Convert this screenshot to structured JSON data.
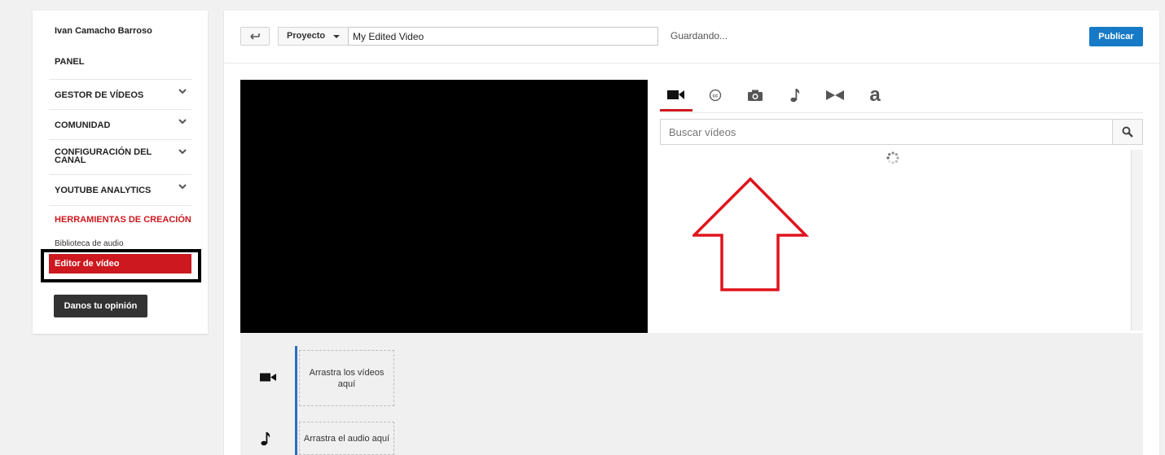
{
  "sidebar": {
    "user_name": "Ivan Camacho Barroso",
    "panel": "PANEL",
    "groups": [
      {
        "label": "GESTOR DE VÍDEOS"
      },
      {
        "label": "COMUNIDAD"
      },
      {
        "label": "CONFIGURACIÓN DEL CANAL"
      },
      {
        "label": "YOUTUBE ANALYTICS"
      }
    ],
    "creation_tools": "HERRAMIENTAS DE CREACIÓN",
    "audio_library": "Biblioteca de audio",
    "video_editor": "Editor de vídeo",
    "feedback_button": "Danos tu opinión"
  },
  "header": {
    "project_label": "Proyecto",
    "title_value": "My Edited Video",
    "status": "Guardando...",
    "publish_label": "Publicar"
  },
  "tabs": [
    {
      "icon": "video-camera-icon",
      "active": true
    },
    {
      "icon": "closed-captions-icon",
      "active": false
    },
    {
      "icon": "camera-icon",
      "active": false
    },
    {
      "icon": "music-note-icon",
      "active": false
    },
    {
      "icon": "transitions-icon",
      "active": false
    },
    {
      "icon": "text-icon",
      "active": false
    }
  ],
  "search": {
    "placeholder": "Buscar vídeos"
  },
  "timeline": {
    "video_drop": "Arrastra los vídeos aquí",
    "audio_drop": "Arrastra el audio aquí"
  },
  "colors": {
    "accent_red": "#cc181e",
    "publish_blue": "#167ac6",
    "annotation_arrow": "#e0141e"
  }
}
